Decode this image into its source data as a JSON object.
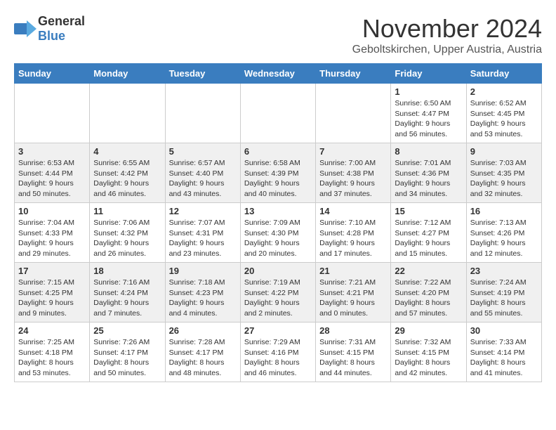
{
  "logo": {
    "general": "General",
    "blue": "Blue"
  },
  "title": "November 2024",
  "location": "Geboltskirchen, Upper Austria, Austria",
  "days_of_week": [
    "Sunday",
    "Monday",
    "Tuesday",
    "Wednesday",
    "Thursday",
    "Friday",
    "Saturday"
  ],
  "weeks": [
    [
      {
        "day": "",
        "info": ""
      },
      {
        "day": "",
        "info": ""
      },
      {
        "day": "",
        "info": ""
      },
      {
        "day": "",
        "info": ""
      },
      {
        "day": "",
        "info": ""
      },
      {
        "day": "1",
        "info": "Sunrise: 6:50 AM\nSunset: 4:47 PM\nDaylight: 9 hours and 56 minutes."
      },
      {
        "day": "2",
        "info": "Sunrise: 6:52 AM\nSunset: 4:45 PM\nDaylight: 9 hours and 53 minutes."
      }
    ],
    [
      {
        "day": "3",
        "info": "Sunrise: 6:53 AM\nSunset: 4:44 PM\nDaylight: 9 hours and 50 minutes."
      },
      {
        "day": "4",
        "info": "Sunrise: 6:55 AM\nSunset: 4:42 PM\nDaylight: 9 hours and 46 minutes."
      },
      {
        "day": "5",
        "info": "Sunrise: 6:57 AM\nSunset: 4:40 PM\nDaylight: 9 hours and 43 minutes."
      },
      {
        "day": "6",
        "info": "Sunrise: 6:58 AM\nSunset: 4:39 PM\nDaylight: 9 hours and 40 minutes."
      },
      {
        "day": "7",
        "info": "Sunrise: 7:00 AM\nSunset: 4:38 PM\nDaylight: 9 hours and 37 minutes."
      },
      {
        "day": "8",
        "info": "Sunrise: 7:01 AM\nSunset: 4:36 PM\nDaylight: 9 hours and 34 minutes."
      },
      {
        "day": "9",
        "info": "Sunrise: 7:03 AM\nSunset: 4:35 PM\nDaylight: 9 hours and 32 minutes."
      }
    ],
    [
      {
        "day": "10",
        "info": "Sunrise: 7:04 AM\nSunset: 4:33 PM\nDaylight: 9 hours and 29 minutes."
      },
      {
        "day": "11",
        "info": "Sunrise: 7:06 AM\nSunset: 4:32 PM\nDaylight: 9 hours and 26 minutes."
      },
      {
        "day": "12",
        "info": "Sunrise: 7:07 AM\nSunset: 4:31 PM\nDaylight: 9 hours and 23 minutes."
      },
      {
        "day": "13",
        "info": "Sunrise: 7:09 AM\nSunset: 4:30 PM\nDaylight: 9 hours and 20 minutes."
      },
      {
        "day": "14",
        "info": "Sunrise: 7:10 AM\nSunset: 4:28 PM\nDaylight: 9 hours and 17 minutes."
      },
      {
        "day": "15",
        "info": "Sunrise: 7:12 AM\nSunset: 4:27 PM\nDaylight: 9 hours and 15 minutes."
      },
      {
        "day": "16",
        "info": "Sunrise: 7:13 AM\nSunset: 4:26 PM\nDaylight: 9 hours and 12 minutes."
      }
    ],
    [
      {
        "day": "17",
        "info": "Sunrise: 7:15 AM\nSunset: 4:25 PM\nDaylight: 9 hours and 9 minutes."
      },
      {
        "day": "18",
        "info": "Sunrise: 7:16 AM\nSunset: 4:24 PM\nDaylight: 9 hours and 7 minutes."
      },
      {
        "day": "19",
        "info": "Sunrise: 7:18 AM\nSunset: 4:23 PM\nDaylight: 9 hours and 4 minutes."
      },
      {
        "day": "20",
        "info": "Sunrise: 7:19 AM\nSunset: 4:22 PM\nDaylight: 9 hours and 2 minutes."
      },
      {
        "day": "21",
        "info": "Sunrise: 7:21 AM\nSunset: 4:21 PM\nDaylight: 9 hours and 0 minutes."
      },
      {
        "day": "22",
        "info": "Sunrise: 7:22 AM\nSunset: 4:20 PM\nDaylight: 8 hours and 57 minutes."
      },
      {
        "day": "23",
        "info": "Sunrise: 7:24 AM\nSunset: 4:19 PM\nDaylight: 8 hours and 55 minutes."
      }
    ],
    [
      {
        "day": "24",
        "info": "Sunrise: 7:25 AM\nSunset: 4:18 PM\nDaylight: 8 hours and 53 minutes."
      },
      {
        "day": "25",
        "info": "Sunrise: 7:26 AM\nSunset: 4:17 PM\nDaylight: 8 hours and 50 minutes."
      },
      {
        "day": "26",
        "info": "Sunrise: 7:28 AM\nSunset: 4:17 PM\nDaylight: 8 hours and 48 minutes."
      },
      {
        "day": "27",
        "info": "Sunrise: 7:29 AM\nSunset: 4:16 PM\nDaylight: 8 hours and 46 minutes."
      },
      {
        "day": "28",
        "info": "Sunrise: 7:31 AM\nSunset: 4:15 PM\nDaylight: 8 hours and 44 minutes."
      },
      {
        "day": "29",
        "info": "Sunrise: 7:32 AM\nSunset: 4:15 PM\nDaylight: 8 hours and 42 minutes."
      },
      {
        "day": "30",
        "info": "Sunrise: 7:33 AM\nSunset: 4:14 PM\nDaylight: 8 hours and 41 minutes."
      }
    ]
  ]
}
